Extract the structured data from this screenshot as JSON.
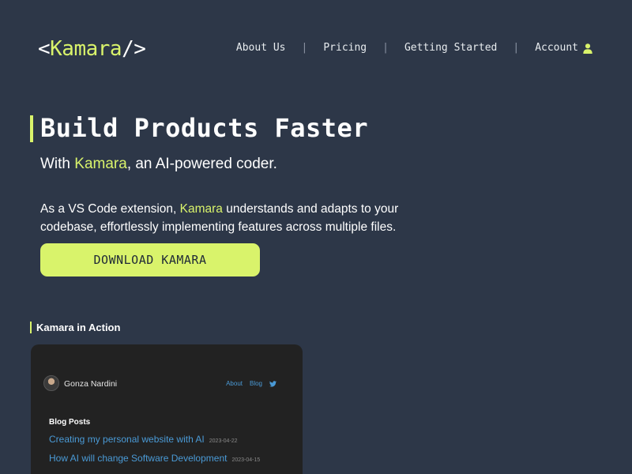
{
  "header": {
    "logo": {
      "open": "<",
      "name": "Kamara",
      "close": "/>"
    },
    "nav": [
      {
        "label": "About Us"
      },
      {
        "label": "Pricing"
      },
      {
        "label": "Getting Started"
      },
      {
        "label": "Account",
        "icon": "user-icon"
      }
    ],
    "separator": "|"
  },
  "hero": {
    "title": "Build Products Faster",
    "subtitle": {
      "prefix": "With ",
      "brand": "Kamara",
      "suffix": ", an AI-powered coder."
    },
    "description": {
      "prefix": "As a VS Code extension, ",
      "brand": "Kamara",
      "suffix": " understands and adapts to your codebase, effortlessly implementing features across multiple files."
    },
    "download_label": "DOWNLOAD KAMARA"
  },
  "in_action": {
    "title": "Kamara in Action",
    "preview": {
      "author": "Gonza Nardini",
      "nav": [
        {
          "label": "About"
        },
        {
          "label": "Blog"
        }
      ],
      "nav_icon": "twitter-icon",
      "section_title": "Blog Posts",
      "posts": [
        {
          "title": "Creating my personal website with AI",
          "date": "2023-04-22"
        },
        {
          "title": "How AI will change Software Development",
          "date": "2023-04-15"
        }
      ]
    }
  },
  "colors": {
    "background": "#2d3748",
    "accent": "#d9f36b",
    "preview_background": "#222222",
    "link_blue": "#4a9ad6"
  }
}
